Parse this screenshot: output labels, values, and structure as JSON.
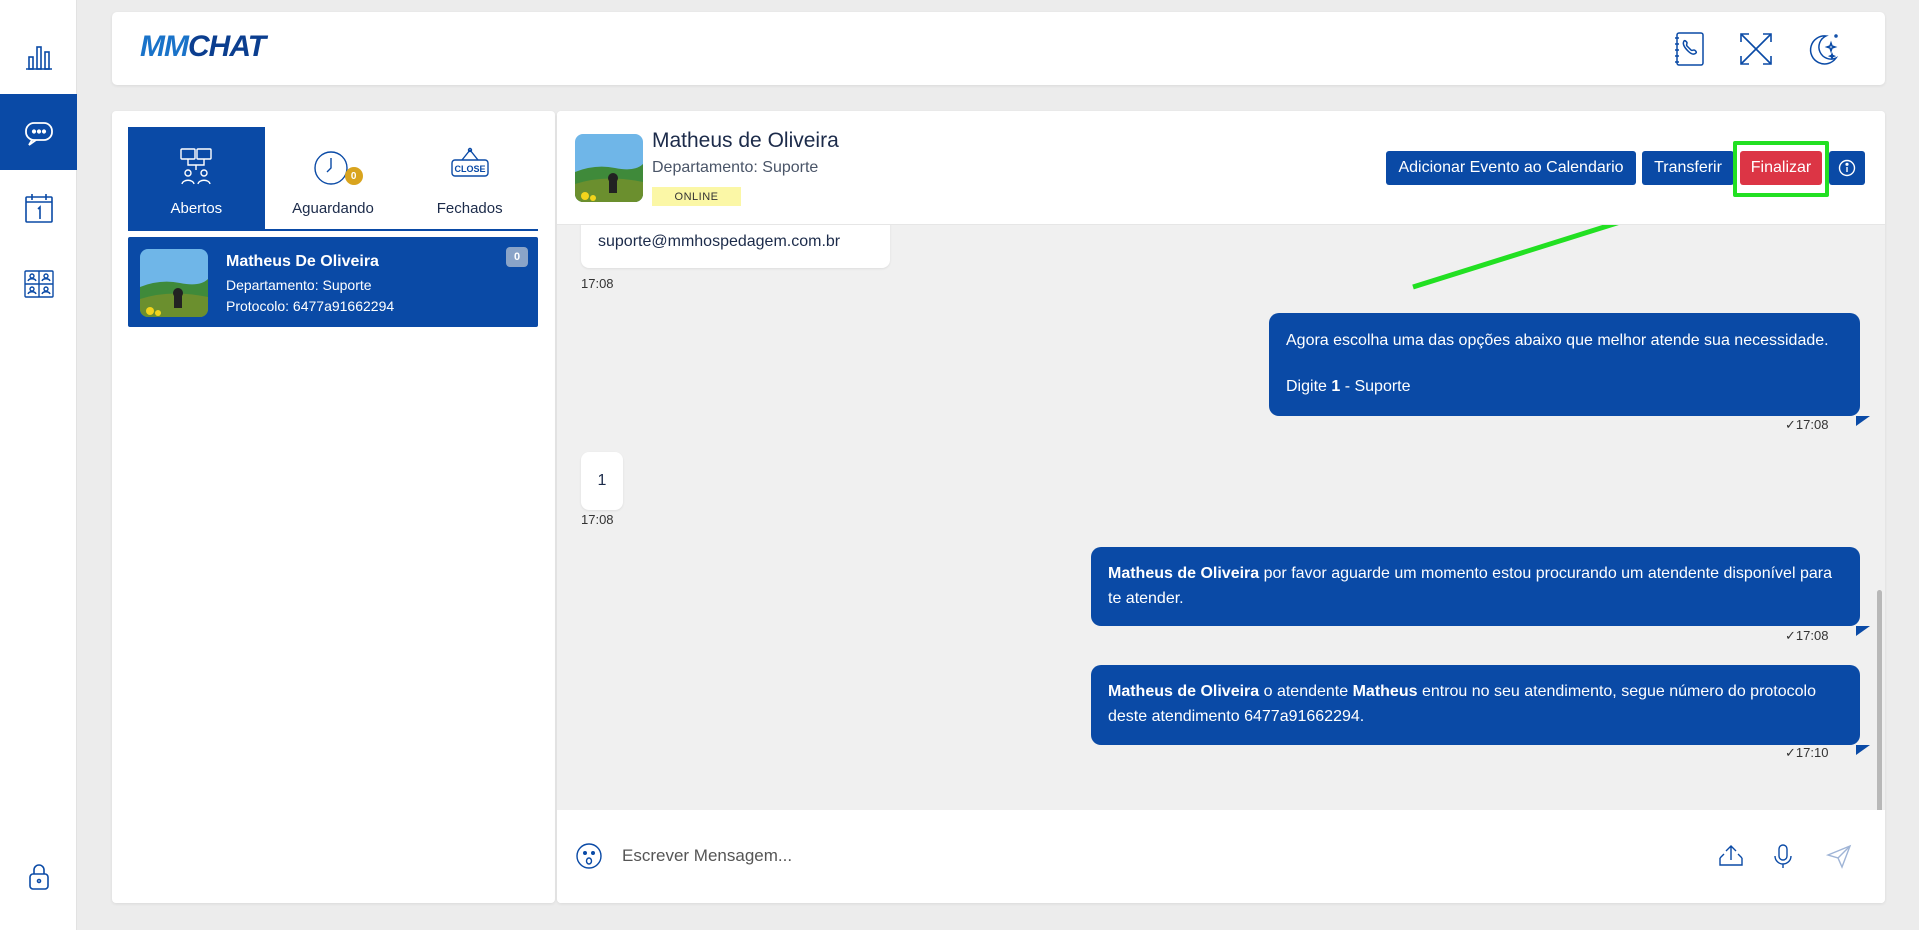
{
  "app": {
    "logo_mm": "MM",
    "logo_chat": "CHAT"
  },
  "rail": {
    "items": [
      "dashboard",
      "chat",
      "calendar",
      "contacts"
    ],
    "active": "chat",
    "bottom": "lock"
  },
  "tabs": [
    {
      "label": "Abertos",
      "icon": "flow-users-icon",
      "active": true
    },
    {
      "label": "Aguardando",
      "icon": "clock-icon",
      "badge": "0"
    },
    {
      "label": "Fechados",
      "icon": "close-sign-icon"
    }
  ],
  "chat_list": [
    {
      "name": "Matheus De Oliveira",
      "department": "Departamento: Suporte",
      "protocol": "Protocolo: 6477a91662294",
      "unread": "0"
    }
  ],
  "contact": {
    "name": "Matheus de Oliveira",
    "department": "Departamento: Suporte",
    "status": "ONLINE"
  },
  "actions": {
    "add_event": "Adicionar Evento ao Calendario",
    "transfer": "Transferir",
    "finish": "Finalizar",
    "info": "i"
  },
  "messages": {
    "m1": {
      "text": "suporte@mmhospedagem.com.br",
      "time": "17:08"
    },
    "m2": {
      "line1": "Agora escolha uma das opções abaixo que melhor atende sua necessidade.",
      "line2_pre": "Digite ",
      "line2_bold": "1",
      "line2_post": " - Suporte",
      "time": "17:08"
    },
    "m3": {
      "text": "1",
      "time": "17:08"
    },
    "m4": {
      "bold": "Matheus de Oliveira",
      "text": " por favor aguarde um momento estou procurando um atendente disponível para te atender.",
      "time": "17:08"
    },
    "m5": {
      "bold1": "Matheus de Oliveira",
      "text1": " o atendente ",
      "bold2": "Matheus",
      "text2": " entrou no seu atendimento, segue número do protocolo deste atendimento 6477a91662294.",
      "time": "17:10"
    }
  },
  "composer": {
    "placeholder": "Escrever Mensagem..."
  },
  "colors": {
    "primary": "#0a4aa6",
    "danger": "#dc3545",
    "highlight": "#22e022",
    "online_bg": "#fbf7a6"
  }
}
